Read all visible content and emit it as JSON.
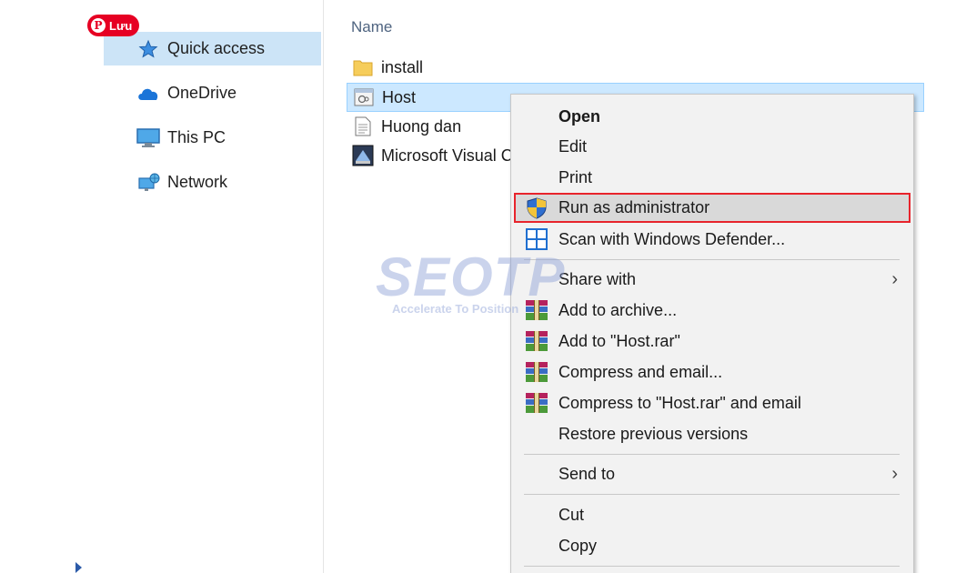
{
  "badge": {
    "label": "Lưu",
    "icon": "pinterest-icon"
  },
  "nav": {
    "items": [
      {
        "label": "Quick access",
        "icon": "star-icon",
        "selected": true
      },
      {
        "label": "OneDrive",
        "icon": "cloud-icon"
      },
      {
        "label": "This PC",
        "icon": "monitor-icon"
      },
      {
        "label": "Network",
        "icon": "network-icon"
      }
    ]
  },
  "files": {
    "column_header": "Name",
    "rows": [
      {
        "name": "install",
        "icon": "folder-icon"
      },
      {
        "name": "Host",
        "icon": "application-icon",
        "selected": true
      },
      {
        "name": "Huong dan",
        "icon": "text-document-icon"
      },
      {
        "name": "Microsoft Visual C",
        "icon": "installer-icon"
      }
    ]
  },
  "context_menu": {
    "items": [
      {
        "label": "Open",
        "bold": true
      },
      {
        "label": "Edit"
      },
      {
        "label": "Print"
      },
      {
        "label": "Run as administrator",
        "icon": "uac-shield-icon",
        "highlighted": true
      },
      {
        "label": "Scan with Windows Defender...",
        "icon": "defender-icon"
      },
      {
        "label": "Share with",
        "submenu": true,
        "submenu_glyph": "›"
      },
      {
        "label": "Add to archive...",
        "icon": "winrar-icon"
      },
      {
        "label": "Add to \"Host.rar\"",
        "icon": "winrar-icon"
      },
      {
        "label": "Compress and email...",
        "icon": "winrar-icon"
      },
      {
        "label": "Compress to \"Host.rar\" and email",
        "icon": "winrar-icon"
      },
      {
        "label": "Restore previous versions"
      },
      {
        "label": "Send to",
        "submenu": true,
        "submenu_glyph": "›"
      },
      {
        "label": "Cut"
      },
      {
        "label": "Copy"
      }
    ]
  },
  "watermark": {
    "brand": "SEOTP",
    "tagline": "Accelerate To Position"
  },
  "colors": {
    "selection": "#cce4f7",
    "highlight_border": "#e8242c",
    "menu_bg": "#f2f2f2",
    "pinterest_red": "#e60023"
  }
}
